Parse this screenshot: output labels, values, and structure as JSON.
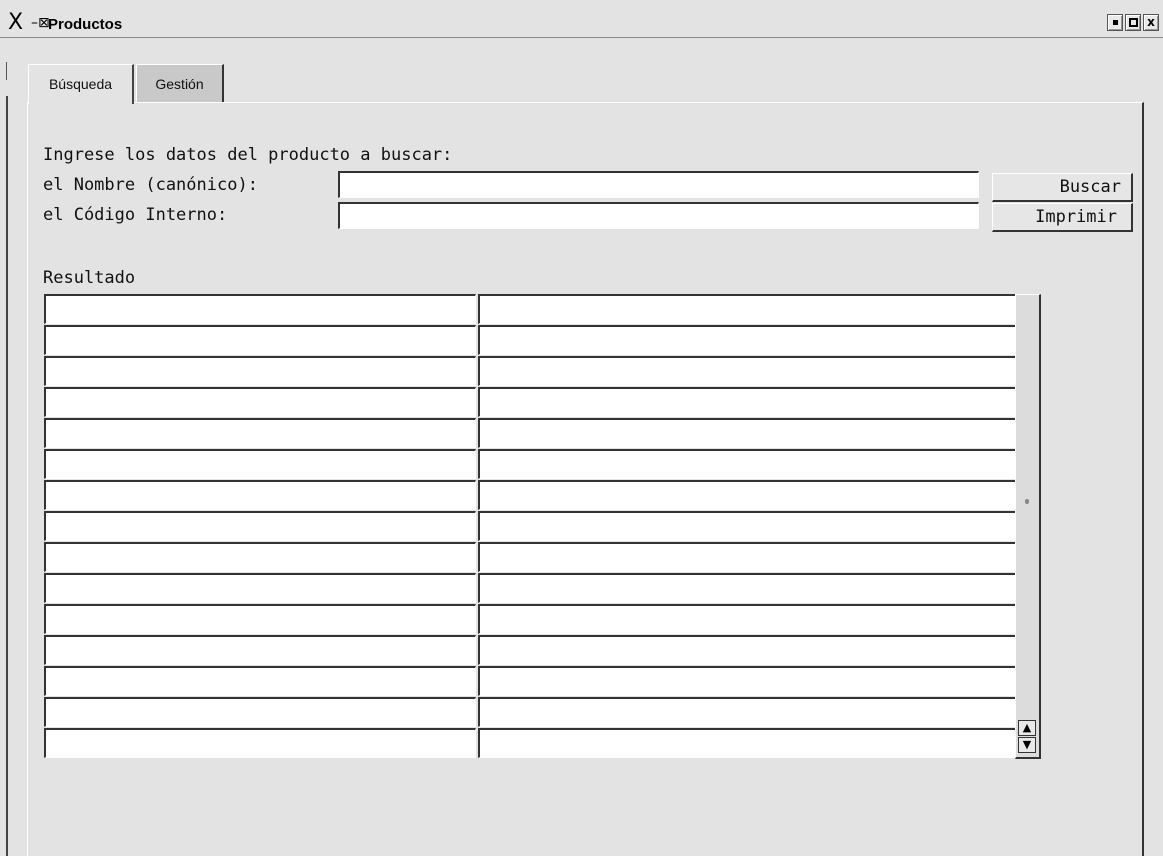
{
  "window": {
    "title": "Productos",
    "app_icon": "x-icon",
    "pin_icon": "pin-icon",
    "controls": [
      "minimize-icon",
      "maximize-icon",
      "close-icon"
    ],
    "close_glyph": "x"
  },
  "tabs": [
    {
      "label": "Búsqueda",
      "active": true
    },
    {
      "label": "Gestión",
      "active": false
    }
  ],
  "search": {
    "heading": "Ingrese los datos del producto a buscar:",
    "name_label": "el Nombre (canónico):",
    "name_value": "",
    "code_label": "el Código Interno:",
    "code_value": "",
    "buscar_label": "Buscar",
    "imprimir_label": "Imprimir"
  },
  "results": {
    "label": "Resultado",
    "rows": [
      [
        "",
        ""
      ],
      [
        "",
        ""
      ],
      [
        "",
        ""
      ],
      [
        "",
        ""
      ],
      [
        "",
        ""
      ],
      [
        "",
        ""
      ],
      [
        "",
        ""
      ],
      [
        "",
        ""
      ],
      [
        "",
        ""
      ],
      [
        "",
        ""
      ],
      [
        "",
        ""
      ],
      [
        "",
        ""
      ],
      [
        "",
        ""
      ],
      [
        "",
        ""
      ],
      [
        "",
        ""
      ]
    ]
  },
  "scrollbar": {
    "up_glyph": "▲",
    "down_glyph": "▼"
  }
}
